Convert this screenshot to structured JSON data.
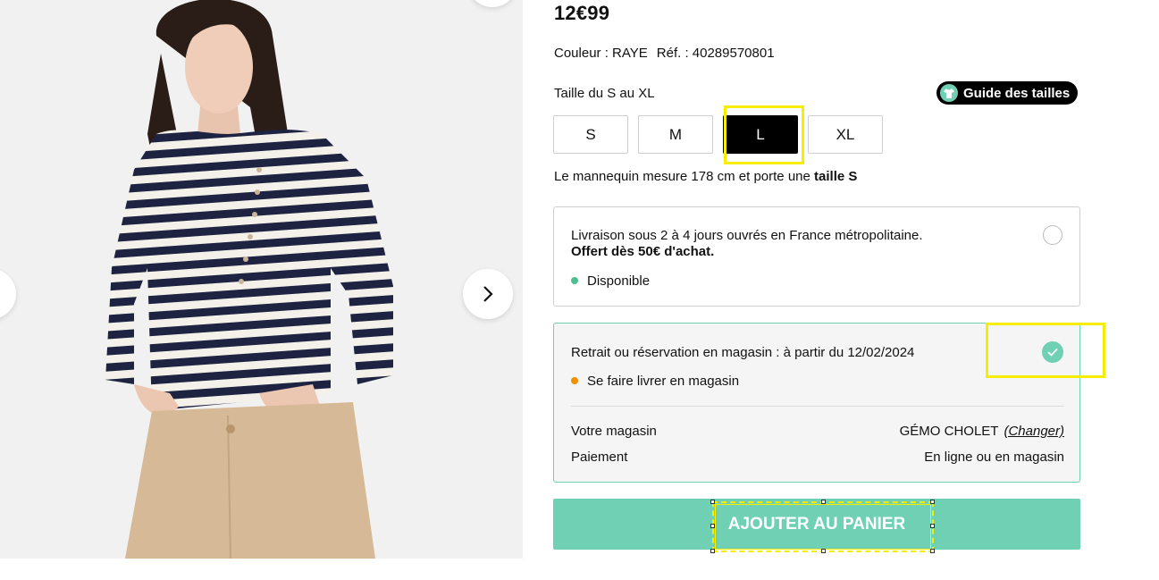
{
  "product": {
    "price": "12€99",
    "color_label": "Couleur : RAYE",
    "ref_label": "Réf. : 40289570801"
  },
  "sizes": {
    "title": "Taille du S au XL",
    "guide_label": "Guide des tailles",
    "options": [
      "S",
      "M",
      "L",
      "XL"
    ],
    "selected": "L",
    "model_note_prefix": "Le mannequin mesure 178 cm et porte une ",
    "model_note_size": "taille S"
  },
  "delivery_home": {
    "line1": "Livraison sous 2 à 4 jours ouvrés en France métropolitaine.",
    "line2": "Offert dès 50€ d'achat.",
    "availability": "Disponible",
    "availability_color": "#4cbf8c",
    "selected": false
  },
  "delivery_store": {
    "title": "Retrait ou réservation en magasin : à partir du 12/02/2024",
    "availability": "Se faire livrer en magasin",
    "availability_color": "#f29100",
    "selected": true,
    "store_label": "Votre magasin",
    "store_name": "GÉMO CHOLET",
    "change_label": "(Changer)",
    "payment_label": "Paiement",
    "payment_value": "En ligne ou en magasin"
  },
  "cart": {
    "button_label": "AJOUTER AU PANIER"
  },
  "colors": {
    "accent": "#6fd0b4",
    "highlight": "#f5ee00"
  }
}
